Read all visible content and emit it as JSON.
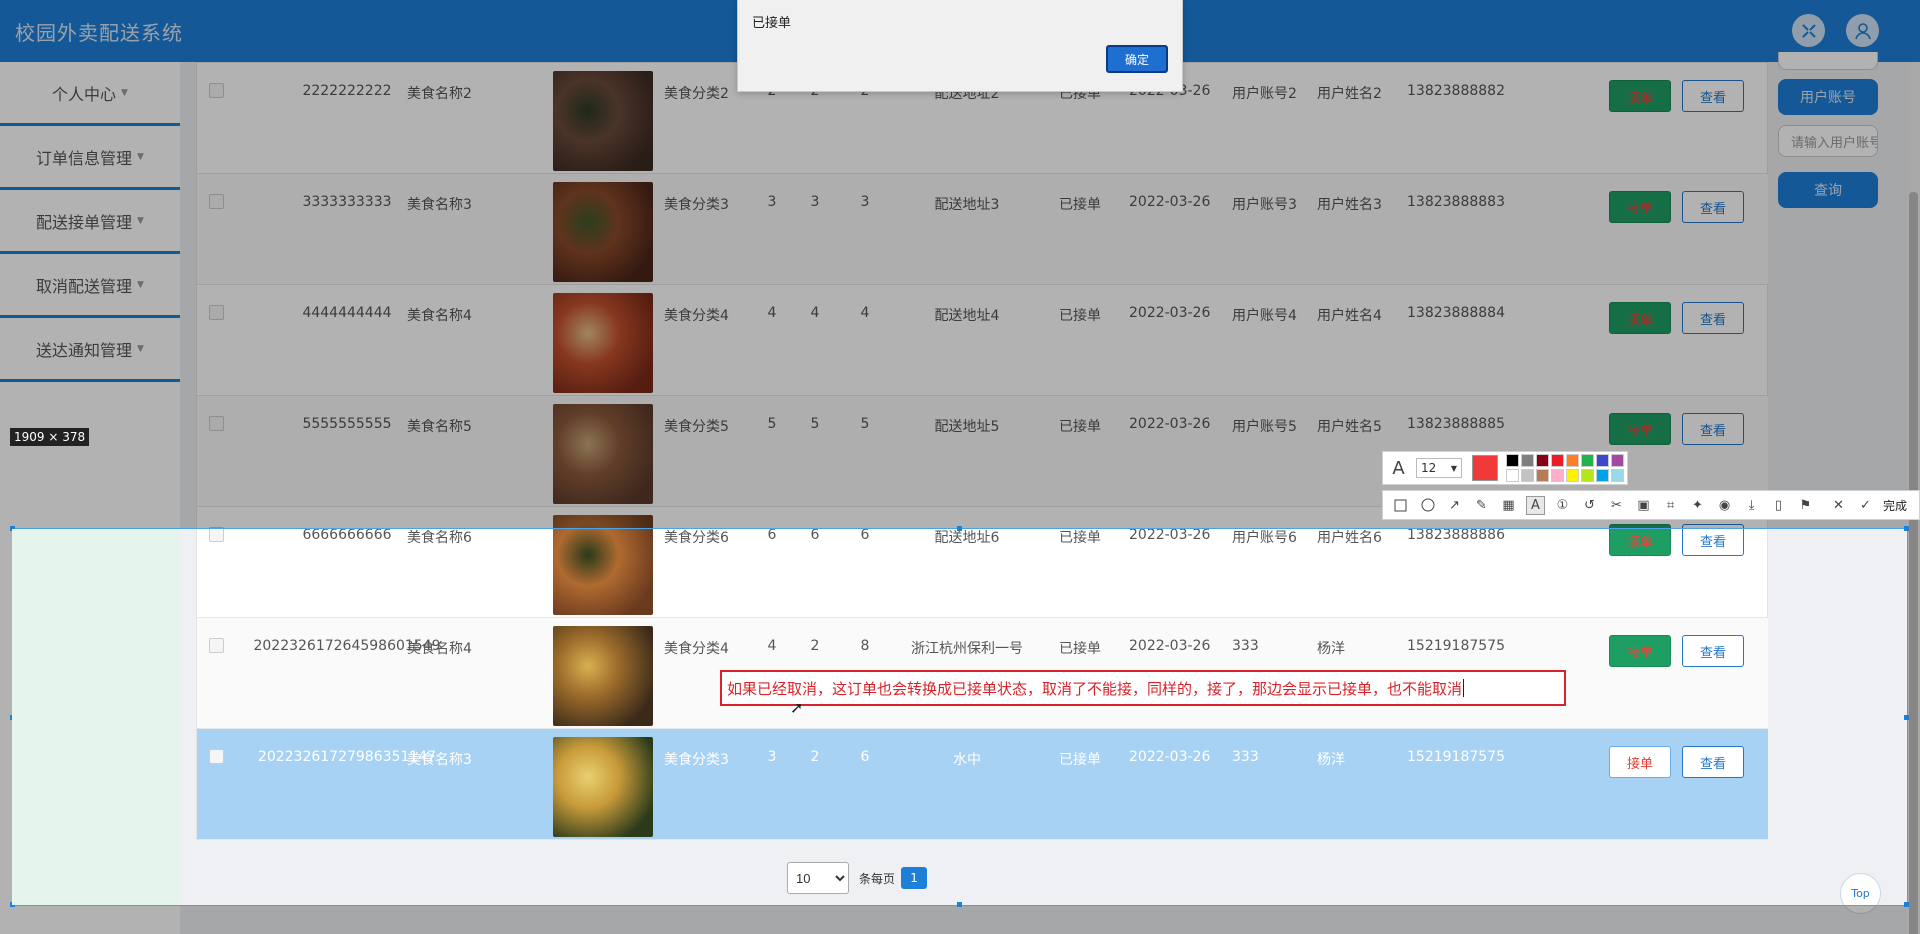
{
  "app": {
    "title": "校园外卖配送系统"
  },
  "sidebar": {
    "items": [
      {
        "label": "个人中心"
      },
      {
        "label": "订单信息管理"
      },
      {
        "label": "配送接单管理"
      },
      {
        "label": "取消配送管理"
      },
      {
        "label": "送达通知管理"
      }
    ]
  },
  "search_panel": {
    "account_button": "用户账号",
    "input_placeholder": "请输入用户账号",
    "query_button": "查询"
  },
  "rows": [
    {
      "order_no": "2222222222",
      "food": "美食名称2",
      "category": "美食分类2",
      "n1": "2",
      "n2": "2",
      "n3": "2",
      "address": "配送地址2",
      "status": "已接单",
      "date": "2022-03-26",
      "account": "用户账号2",
      "name": "用户姓名2",
      "phone": "13823888882",
      "accept": "接单",
      "view": "查看"
    },
    {
      "order_no": "3333333333",
      "food": "美食名称3",
      "category": "美食分类3",
      "n1": "3",
      "n2": "3",
      "n3": "3",
      "address": "配送地址3",
      "status": "已接单",
      "date": "2022-03-26",
      "account": "用户账号3",
      "name": "用户姓名3",
      "phone": "13823888883",
      "accept": "接单",
      "view": "查看"
    },
    {
      "order_no": "4444444444",
      "food": "美食名称4",
      "category": "美食分类4",
      "n1": "4",
      "n2": "4",
      "n3": "4",
      "address": "配送地址4",
      "status": "已接单",
      "date": "2022-03-26",
      "account": "用户账号4",
      "name": "用户姓名4",
      "phone": "13823888884",
      "accept": "接单",
      "view": "查看"
    },
    {
      "order_no": "5555555555",
      "food": "美食名称5",
      "category": "美食分类5",
      "n1": "5",
      "n2": "5",
      "n3": "5",
      "address": "配送地址5",
      "status": "已接单",
      "date": "2022-03-26",
      "account": "用户账号5",
      "name": "用户姓名5",
      "phone": "13823888885",
      "accept": "接单",
      "view": "查看"
    },
    {
      "order_no": "6666666666",
      "food": "美食名称6",
      "category": "美食分类6",
      "n1": "6",
      "n2": "6",
      "n3": "6",
      "address": "配送地址6",
      "status": "已接单",
      "date": "2022-03-26",
      "account": "用户账号6",
      "name": "用户姓名6",
      "phone": "13823888886",
      "accept": "接单",
      "view": "查看"
    },
    {
      "order_no": "202232617264598601549",
      "food": "美食名称4",
      "category": "美食分类4",
      "n1": "4",
      "n2": "2",
      "n3": "8",
      "address": "浙江杭州保利一号",
      "status": "已接单",
      "date": "2022-03-26",
      "account": "333",
      "name": "杨洋",
      "phone": "15219187575",
      "accept": "接单",
      "view": "查看"
    },
    {
      "order_no": "20223261727986351147",
      "food": "美食名称3",
      "category": "美食分类3",
      "n1": "3",
      "n2": "2",
      "n3": "6",
      "address": "水中",
      "status": "已接单",
      "date": "2022-03-26",
      "account": "333",
      "name": "杨洋",
      "phone": "15219187575",
      "accept": "接单",
      "view": "查看"
    }
  ],
  "pager": {
    "page_size": "10",
    "per_page_label": "条每页",
    "current_page": "1"
  },
  "dialog": {
    "message": "已接单",
    "ok": "确定"
  },
  "screenshot_tool": {
    "size_label": "1909 × 378",
    "font_size": "12",
    "current_color": "#f03a3a",
    "palette": [
      "#000000",
      "#7f7f7f",
      "#880015",
      "#ed1c24",
      "#ff7f27",
      "#22b14c",
      "#3f48cc",
      "#a349a4",
      "#ffffff",
      "#c3c3c3",
      "#b97a57",
      "#ffaec9",
      "#fff200",
      "#b5e61d",
      "#00a2e8",
      "#99d9ea"
    ],
    "done_label": "完成",
    "annotation_text": "如果已经取消，这订单也会转换成已接单状态，取消了不能接，同样的，接了，那边会显示已接单，也不能取消"
  },
  "top_button": "Top"
}
